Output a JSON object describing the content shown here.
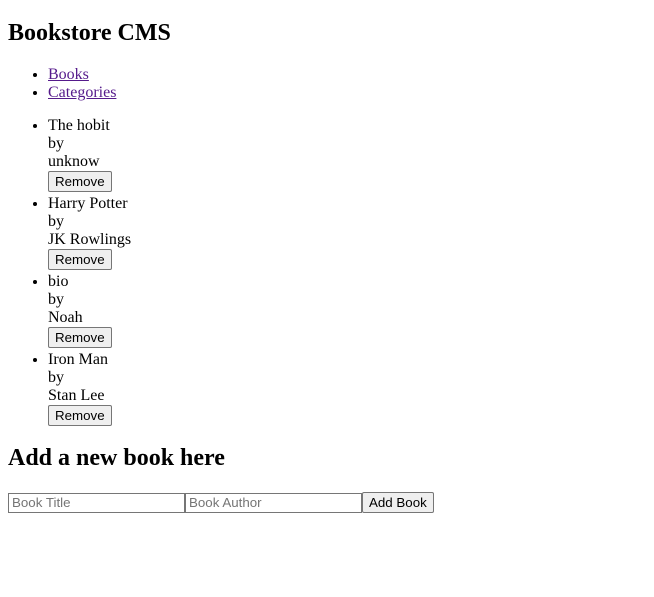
{
  "header": {
    "title": "Bookstore CMS"
  },
  "nav": {
    "items": [
      {
        "label": "Books"
      },
      {
        "label": "Categories"
      }
    ]
  },
  "books": [
    {
      "title": "The hobit",
      "by": "by",
      "author": "unknow",
      "remove_label": "Remove"
    },
    {
      "title": "Harry Potter",
      "by": "by",
      "author": "JK Rowlings",
      "remove_label": "Remove"
    },
    {
      "title": "bio",
      "by": "by",
      "author": "Noah",
      "remove_label": "Remove"
    },
    {
      "title": "Iron Man",
      "by": "by",
      "author": "Stan Lee",
      "remove_label": "Remove"
    }
  ],
  "add_form": {
    "heading": "Add a new book here",
    "title_placeholder": "Book Title",
    "author_placeholder": "Book Author",
    "submit_label": "Add Book"
  }
}
